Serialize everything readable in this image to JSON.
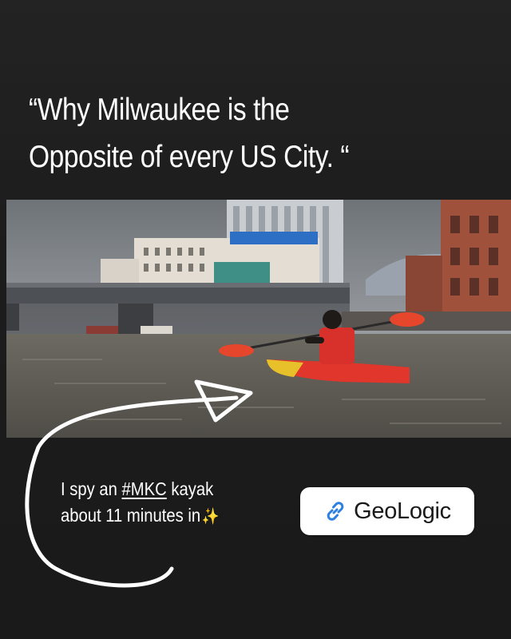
{
  "story": {
    "headline_lines": [
      "“Why Milwaukee is the",
      "Opposite of every US City. “"
    ]
  },
  "caption": {
    "line1_prefix": "I spy an ",
    "hashtag": "#MKC",
    "line1_suffix": " kayak",
    "line2": "about 11 minutes in",
    "emoji": "✨"
  },
  "link_sticker": {
    "label": "GeoLogic",
    "icon": "link-icon"
  },
  "video": {
    "content": "kayaker-on-river-photo"
  },
  "colors": {
    "background": "#1f1f1f",
    "text": "#ffffff",
    "link_icon": "#2f7fe0",
    "kayak": "#e0362b",
    "kayak_bow": "#e8c12a"
  }
}
